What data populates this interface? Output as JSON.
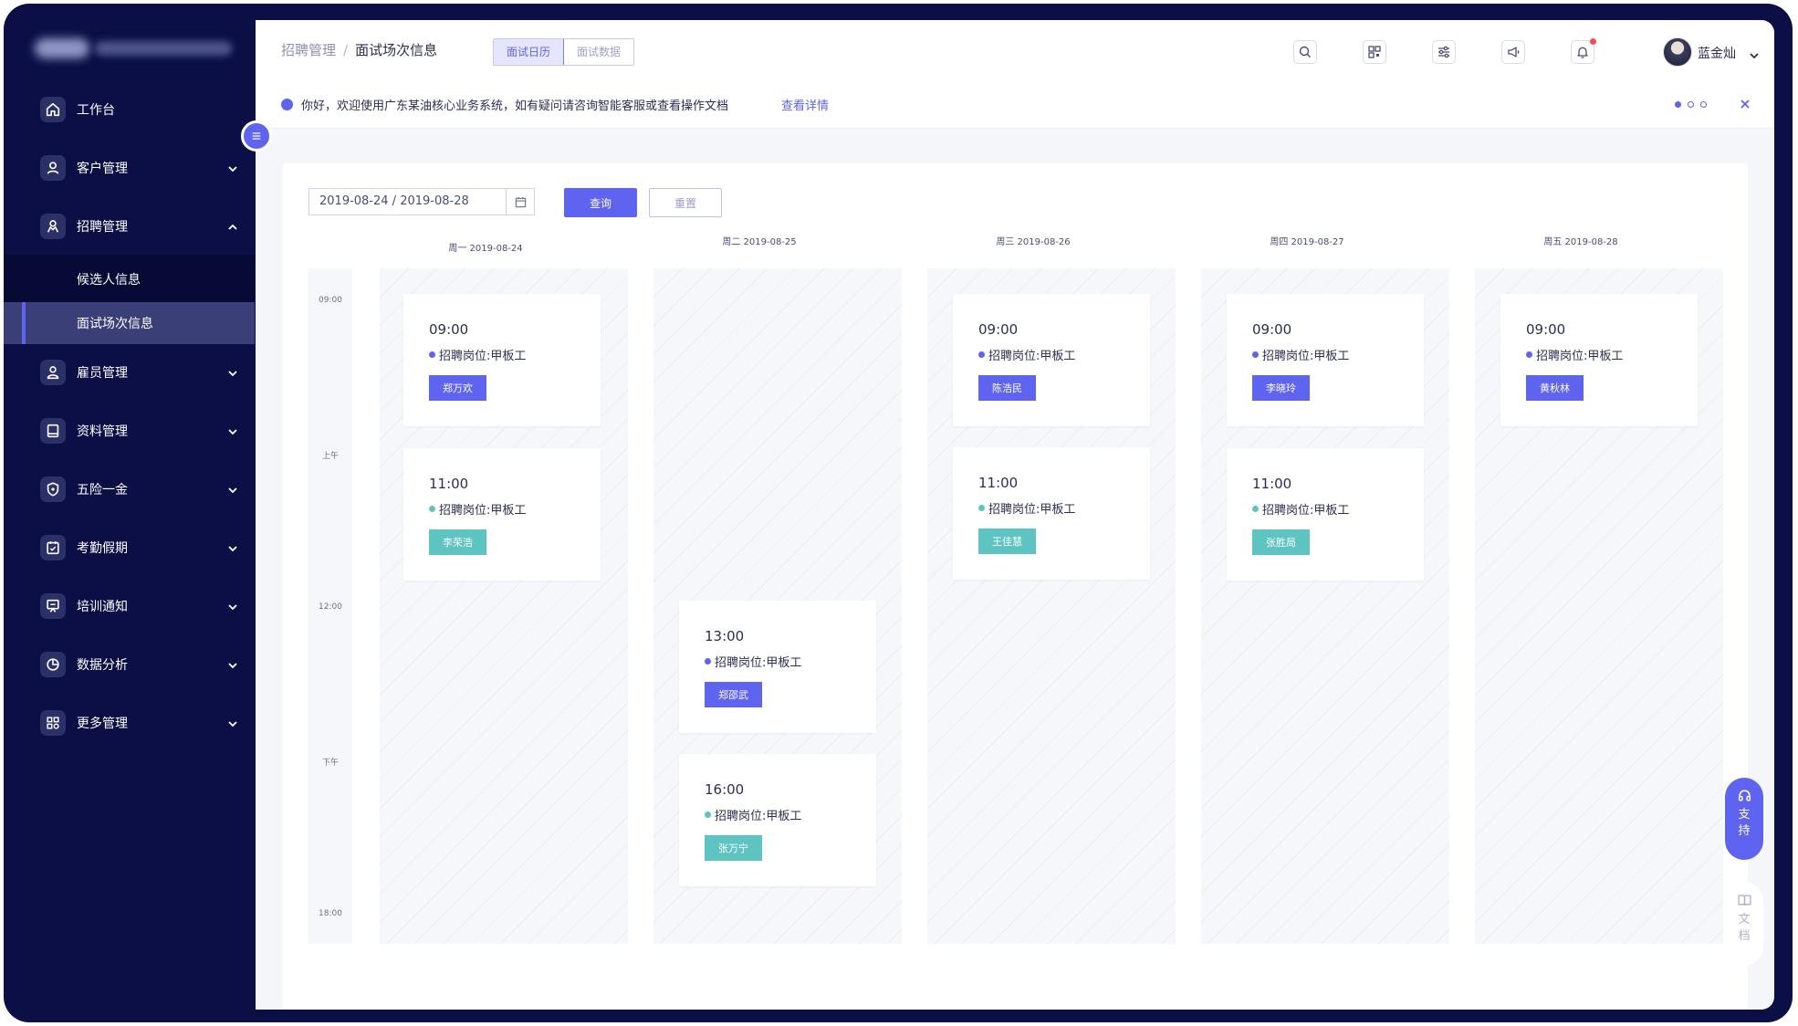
{
  "sidebar": {
    "items": [
      {
        "label": "工作台",
        "icon": "home-icon"
      },
      {
        "label": "客户管理",
        "icon": "user-icon"
      },
      {
        "label": "招聘管理",
        "icon": "recruit-icon"
      },
      {
        "label": "雇员管理",
        "icon": "employee-icon"
      },
      {
        "label": "资料管理",
        "icon": "book-icon"
      },
      {
        "label": "五险一金",
        "icon": "shield-icon"
      },
      {
        "label": "考勤假期",
        "icon": "calendar-check-icon"
      },
      {
        "label": "培训通知",
        "icon": "presentation-icon"
      },
      {
        "label": "数据分析",
        "icon": "pie-chart-icon"
      },
      {
        "label": "更多管理",
        "icon": "grid-icon"
      }
    ],
    "submenu": [
      {
        "label": "候选人信息"
      },
      {
        "label": "面试场次信息"
      }
    ]
  },
  "header": {
    "breadcrumb_parent": "招聘管理",
    "breadcrumb_sep": "/",
    "breadcrumb_current": "面试场次信息",
    "tabs": [
      "面试日历",
      "面试数据"
    ],
    "user_name": "蓝金灿"
  },
  "notice": {
    "text": "你好，欢迎使用广东某油核心业务系统，如有疑问请咨询智能客服或查看操作文档",
    "link": "查看详情"
  },
  "filter": {
    "date_range": "2019-08-24 / 2019-08-28",
    "query_label": "查询",
    "reset_label": "重置"
  },
  "calendar": {
    "days": [
      "周一  2019-08-24",
      "周二  2019-08-25",
      "周三  2019-08-26",
      "周四  2019-08-27",
      "周五  2019-08-28"
    ],
    "time_labels": [
      "09:00",
      "上午",
      "12:00",
      "下午",
      "18:00"
    ],
    "events": [
      {
        "time": "09:00",
        "position": "招聘岗位:甲板工",
        "name": "郑万欢"
      },
      {
        "time": "11:00",
        "position": "招聘岗位:甲板工",
        "name": "李荣浩"
      },
      {
        "time": "13:00",
        "position": "招聘岗位:甲板工",
        "name": "郑邵武"
      },
      {
        "time": "16:00",
        "position": "招聘岗位:甲板工",
        "name": "张万宁"
      },
      {
        "time": "09:00",
        "position": "招聘岗位:甲板工",
        "name": "陈浩民"
      },
      {
        "time": "11:00",
        "position": "招聘岗位:甲板工",
        "name": "王佳慧"
      },
      {
        "time": "09:00",
        "position": "招聘岗位:甲板工",
        "name": "李晓玲"
      },
      {
        "time": "11:00",
        "position": "招聘岗位:甲板工",
        "name": "张胜局"
      },
      {
        "time": "09:00",
        "position": "招聘岗位:甲板工",
        "name": "黄秋林"
      }
    ]
  },
  "float": {
    "support": [
      "支",
      "持"
    ],
    "docs": [
      "文",
      "档"
    ]
  },
  "colors": {
    "sidebar_bg": "#0b0f46",
    "accent": "#5e63f0",
    "teal": "#5ec4c1"
  }
}
